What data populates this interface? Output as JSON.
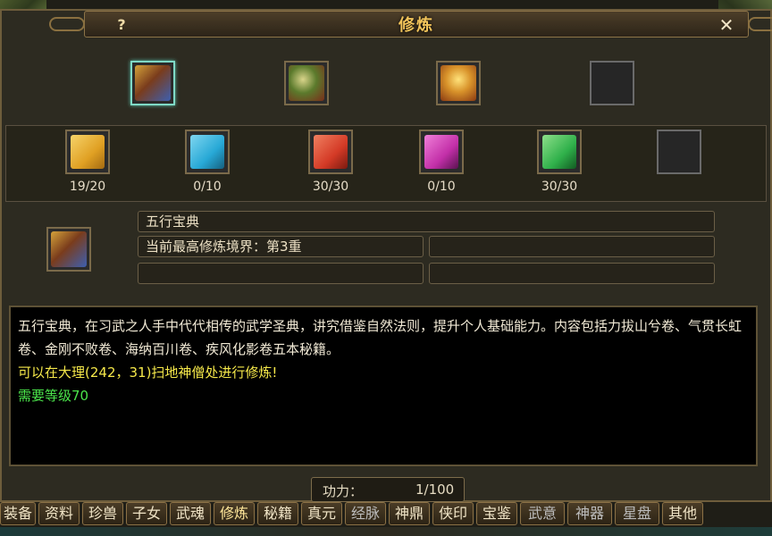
{
  "window": {
    "title": "修炼",
    "help_glyph": "?",
    "close_glyph": "✕"
  },
  "top_slots": [
    {
      "icon": "golden-book-icon",
      "selected": true
    },
    {
      "icon": "scroll-bundle-icon",
      "selected": false
    },
    {
      "icon": "treasure-chest-icon",
      "selected": false
    },
    {
      "icon": "empty-slot",
      "selected": false
    }
  ],
  "book_slots": [
    {
      "icon": "yellow-book-icon",
      "count": "19/20",
      "color": "#e8b02c"
    },
    {
      "icon": "cyan-book-icon",
      "count": "0/10",
      "color": "#27a8d6"
    },
    {
      "icon": "red-book-icon",
      "count": "30/30",
      "color": "#d43a26"
    },
    {
      "icon": "purple-book-icon",
      "count": "0/10",
      "color": "#c22fa8"
    },
    {
      "icon": "green-book-icon",
      "count": "30/30",
      "color": "#2fb04a"
    },
    {
      "icon": "empty-slot",
      "count": ""
    }
  ],
  "detail": {
    "book_name": "五行宝典",
    "highest_level": "当前最高修炼境界：第3重"
  },
  "description": {
    "line1": "五行宝典，在习武之人手中代代相传的武学圣典，讲究借鉴自然法则，提升个人基础能力。内容包括力拔山兮卷、气贯长虹卷、金刚不败卷、海纳百川卷、疾风化影卷五本秘籍。",
    "location": "可以在大理(242，31)扫地神僧处进行修炼!",
    "requirement": "需要等级70"
  },
  "power": {
    "label": "功力：",
    "value": "1/100"
  },
  "tabs": [
    {
      "label": "装备",
      "state": "normal"
    },
    {
      "label": "资料",
      "state": "normal"
    },
    {
      "label": "珍兽",
      "state": "normal"
    },
    {
      "label": "子女",
      "state": "normal"
    },
    {
      "label": "武魂",
      "state": "normal"
    },
    {
      "label": "修炼",
      "state": "active"
    },
    {
      "label": "秘籍",
      "state": "normal"
    },
    {
      "label": "真元",
      "state": "normal"
    },
    {
      "label": "经脉",
      "state": "dim"
    },
    {
      "label": "神鼎",
      "state": "normal"
    },
    {
      "label": "侠印",
      "state": "normal"
    },
    {
      "label": "宝鉴",
      "state": "normal"
    },
    {
      "label": "武意",
      "state": "dim"
    },
    {
      "label": "神器",
      "state": "dim"
    },
    {
      "label": "星盘",
      "state": "dim"
    },
    {
      "label": "其他",
      "state": "normal"
    }
  ]
}
